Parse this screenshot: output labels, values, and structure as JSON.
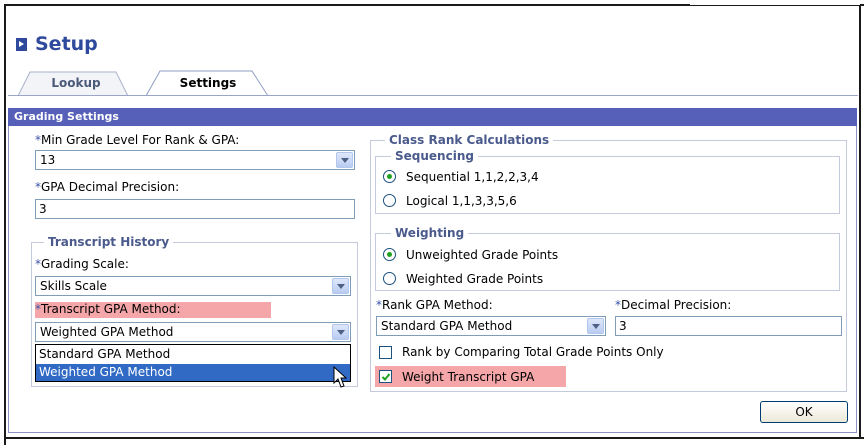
{
  "page": {
    "title": "Setup"
  },
  "tabs": [
    {
      "label": "Lookup",
      "active": false
    },
    {
      "label": "Settings",
      "active": true
    }
  ],
  "section": {
    "title": "Grading Settings"
  },
  "left": {
    "min_grade": {
      "required": "*",
      "label": "Min Grade Level For Rank & GPA:",
      "value": "13"
    },
    "gpa_precision": {
      "required": "*",
      "label": "GPA Decimal Precision:",
      "value": "3"
    },
    "transcript_history": {
      "legend": "Transcript History",
      "grading_scale": {
        "required": "*",
        "label": "Grading Scale:",
        "value": "Skills Scale"
      },
      "transcript_gpa": {
        "required": "*",
        "label": "Transcript GPA Method:",
        "value": "Weighted GPA Method",
        "options": [
          "Standard GPA Method",
          "Weighted GPA Method"
        ],
        "highlighted_option": "Weighted GPA Method"
      }
    }
  },
  "right": {
    "legend": "Class Rank Calculations",
    "sequencing": {
      "legend": "Sequencing",
      "options": [
        {
          "label": "Sequential 1,1,2,2,3,4",
          "selected": true
        },
        {
          "label": "Logical 1,1,3,3,5,6",
          "selected": false
        }
      ]
    },
    "weighting": {
      "legend": "Weighting",
      "options": [
        {
          "label": "Unweighted Grade Points",
          "selected": true
        },
        {
          "label": "Weighted Grade Points",
          "selected": false
        }
      ]
    },
    "rank_gpa": {
      "required": "*",
      "label": "Rank GPA Method:",
      "value": "Standard GPA Method"
    },
    "decimal_precision": {
      "required": "*",
      "label": "Decimal Precision:",
      "value": "3"
    },
    "rank_total_points": {
      "label": "Rank by Comparing Total Grade Points Only",
      "checked": false
    },
    "weight_transcript": {
      "label": "Weight Transcript GPA",
      "checked": true
    }
  },
  "buttons": {
    "ok": "OK"
  },
  "icons": {
    "title": "arrow-right-icon",
    "dropdown": "chevron-down-icon",
    "cursor": "mouse-pointer-icon",
    "check": "checkmark-icon"
  },
  "colors": {
    "title": "#2f4a9c",
    "section_bar": "#5660b8",
    "highlight": "#f4a6a8",
    "selected_option": "#316ac5",
    "radio_dot": "#21a121"
  }
}
